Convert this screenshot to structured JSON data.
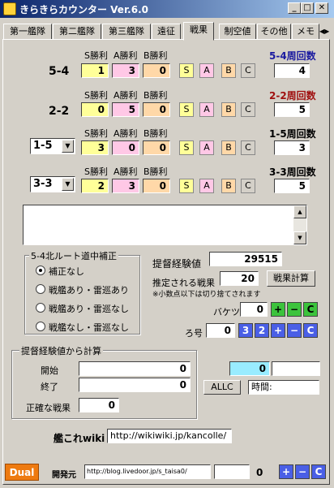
{
  "window": {
    "title": "きらきらカウンター  Ver.6.0",
    "min": "_",
    "max": "□",
    "close": "✕"
  },
  "tabs": [
    "第一艦隊",
    "第二艦隊",
    "第三艦隊",
    "遠征",
    "戦果",
    "制空値",
    "その他",
    "メモ"
  ],
  "col_headers": {
    "s": "S勝利",
    "a": "A勝利",
    "b": "B勝利"
  },
  "rows": [
    {
      "label": "5-4",
      "s": "1",
      "a": "3",
      "b": "0",
      "count_title": "5-4周回数",
      "count": "4",
      "title_color": "#1a1aa0"
    },
    {
      "label": "2-2",
      "s": "0",
      "a": "5",
      "b": "0",
      "count_title": "2-2周回数",
      "count": "5",
      "title_color": "#a01010"
    },
    {
      "label": "1-5",
      "s": "3",
      "a": "0",
      "b": "0",
      "count_title": "1-5周回数",
      "count": "3",
      "title_color": "#000000"
    },
    {
      "label": "3-3",
      "s": "2",
      "a": "3",
      "b": "0",
      "count_title": "3-3周回数",
      "count": "5",
      "title_color": "#000000"
    }
  ],
  "rank_buttons": {
    "s": "S",
    "a": "A",
    "b": "B",
    "c": "C"
  },
  "rank_colors": {
    "s": "#ffff99",
    "a": "#ffc8e6",
    "b": "#ffd8a8",
    "c": "#d4d0c8"
  },
  "route_group": {
    "title": "5-4北ルート道中補正",
    "options": [
      "補正なし",
      "戦艦あり・雷巡あり",
      "戦艦あり・雷巡なし",
      "戦艦なし・雷巡なし"
    ],
    "selected": 0
  },
  "exp": {
    "label": "提督経験値",
    "value": "29515",
    "estimate_label": "推定される戦果",
    "estimate_value": "20",
    "calc_button": "戦果計算",
    "note": "※小数点以下は切り捨てされます"
  },
  "bucket": {
    "label": "バケツ",
    "value": "0"
  },
  "ro": {
    "label": "ろ号",
    "value": "0",
    "b3": "3",
    "b2": "2"
  },
  "ctrl": {
    "plus": "+",
    "minus": "−",
    "clear": "C"
  },
  "calc_group": {
    "title": "提督経験値から計算",
    "start_label": "開始",
    "start_value": "0",
    "end_label": "終了",
    "end_value": "0",
    "exact_label": "正確な戦果",
    "exact_value": "0"
  },
  "timer": {
    "value": "0",
    "allc": "ALLC",
    "time_label": "時間:"
  },
  "wiki": {
    "label": "艦これwiki",
    "url": "http://wikiwiki.jp/kancolle/"
  },
  "footer": {
    "dual": "Dual",
    "dev_label": "開発元",
    "dev_url": "http://blog.livedoor.jp/s_taisa0/",
    "counter": "0"
  },
  "colors": {
    "dual_bg": "#ee7a10",
    "green": "#3cc33c",
    "blue": "#4a5fe6",
    "timer_bg": "#99ecff"
  }
}
